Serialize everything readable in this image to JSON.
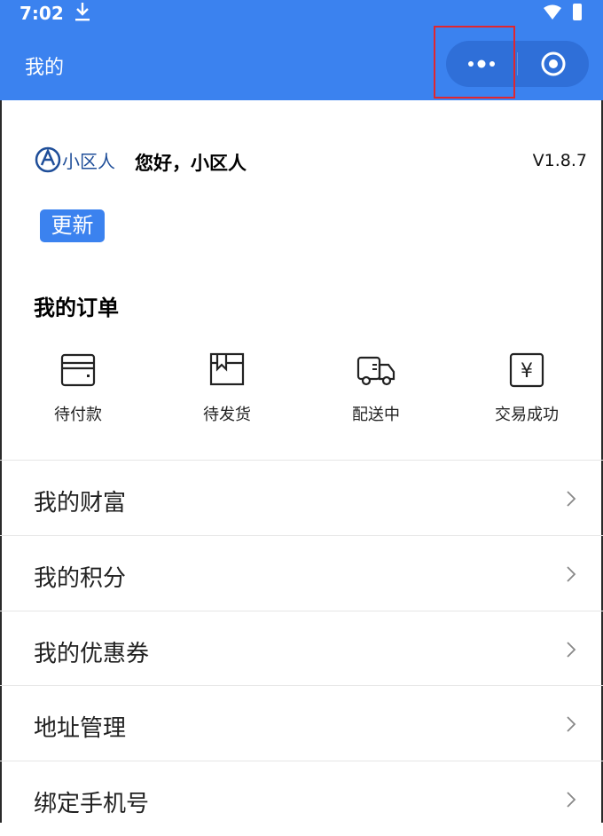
{
  "status_bar": {
    "time": "7:02"
  },
  "header": {
    "title": "我的"
  },
  "user": {
    "greeting": "您好，小区人",
    "version": "V1.8.7",
    "update_label": "更新",
    "logo_text": "小区人"
  },
  "orders": {
    "title": "我的订单",
    "items": [
      {
        "label": "待付款",
        "icon": "wallet-icon"
      },
      {
        "label": "待发货",
        "icon": "package-icon"
      },
      {
        "label": "配送中",
        "icon": "truck-icon"
      },
      {
        "label": "交易成功",
        "icon": "yen-icon",
        "glyph": "¥"
      }
    ]
  },
  "menu": {
    "items": [
      {
        "label": "我的财富"
      },
      {
        "label": "我的积分"
      },
      {
        "label": "我的优惠券"
      },
      {
        "label": "地址管理"
      },
      {
        "label": "绑定手机号"
      }
    ]
  },
  "colors": {
    "primary": "#3b82ef",
    "capsule": "#2f6fd8",
    "highlight": "#e0262e"
  }
}
